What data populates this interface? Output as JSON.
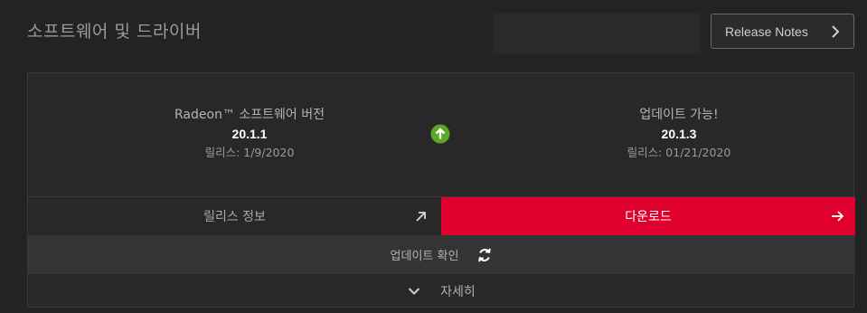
{
  "section": {
    "title": "소프트웨어 및 드라이버"
  },
  "header": {
    "release_notes_label": "Release Notes"
  },
  "current": {
    "title": "Radeon™ 소프트웨어 버전",
    "version": "20.1.1",
    "release_date": "릴리스: 1/9/2020"
  },
  "available": {
    "title": "업데이트 가능!",
    "version": "20.1.3",
    "release_date": "릴리스: 01/21/2020"
  },
  "actions": {
    "release_info_label": "릴리스 정보",
    "download_label": "다운로드",
    "check_update_label": "업데이트 확인",
    "details_label": "자세히"
  },
  "colors": {
    "accent": "#e0002e",
    "upgrade_green": "#5aa82a"
  },
  "icons": {
    "upgrade": "arrow-up-circle-icon",
    "release_notes": "chevron-right-icon",
    "release_info": "arrow-up-right-icon",
    "download": "arrow-right-icon",
    "check_update": "refresh-icon",
    "details": "chevron-down-icon"
  }
}
